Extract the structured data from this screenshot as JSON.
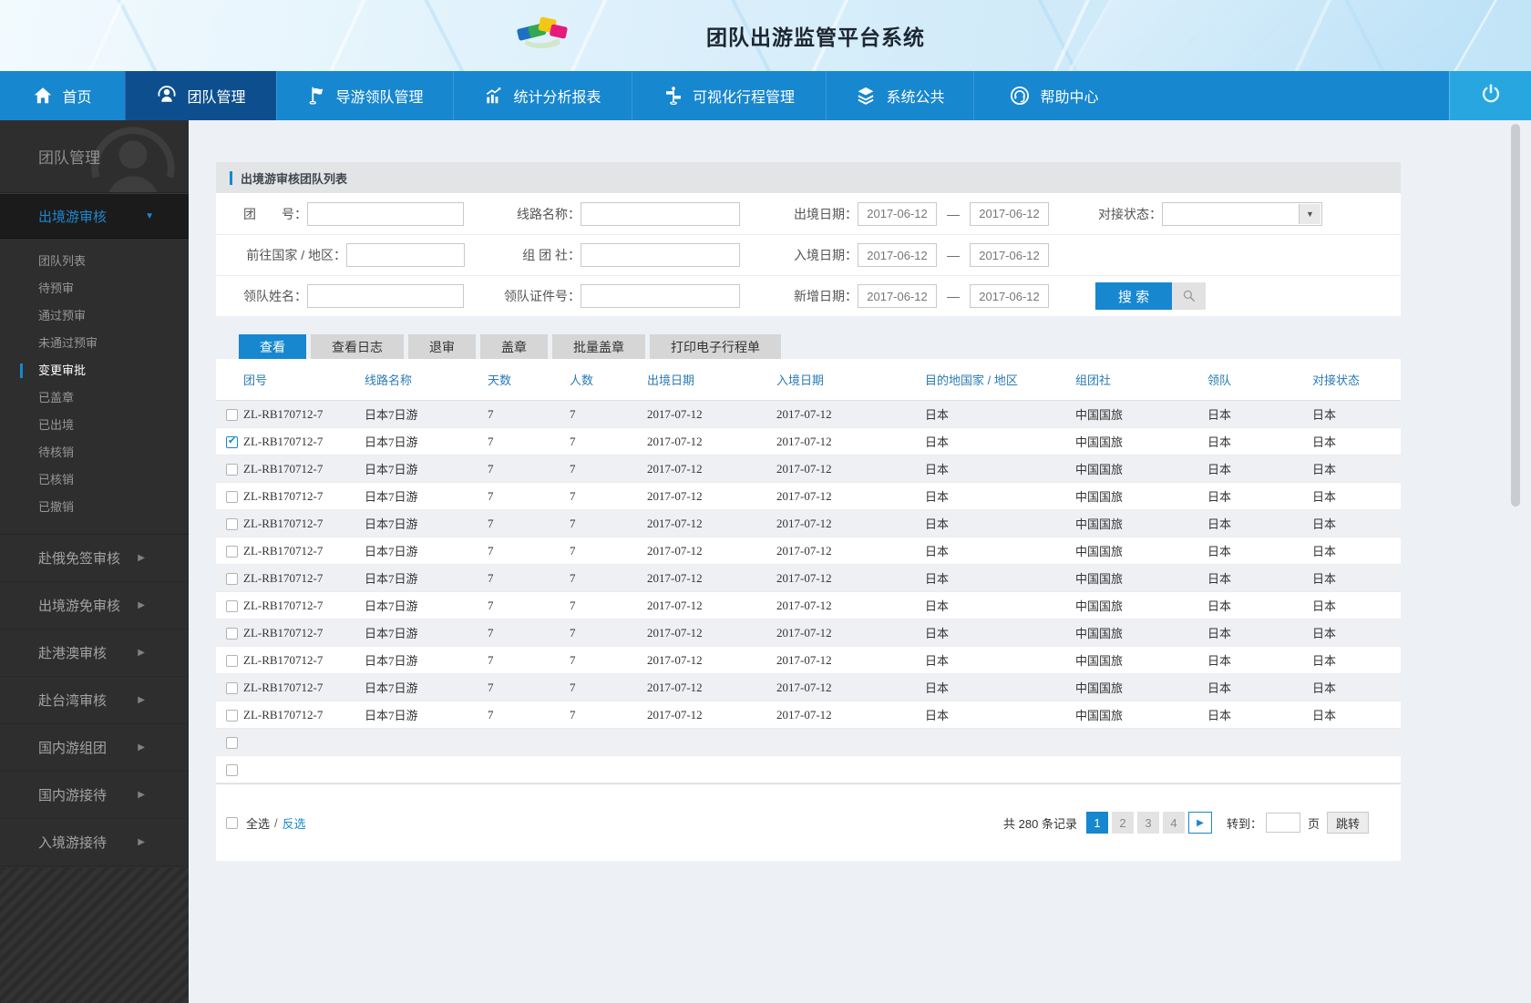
{
  "header": {
    "title": "团队出游监管平台系统"
  },
  "nav": {
    "items": [
      {
        "label": "首页",
        "icon": "home",
        "active": false
      },
      {
        "label": "团队管理",
        "icon": "team",
        "active": true
      },
      {
        "label": "导游领队管理",
        "icon": "flag",
        "active": false
      },
      {
        "label": "统计分析报表",
        "icon": "chart",
        "active": false
      },
      {
        "label": "可视化行程管理",
        "icon": "signpost",
        "active": false
      },
      {
        "label": "系统公共",
        "icon": "layers",
        "active": false
      },
      {
        "label": "帮助中心",
        "icon": "headset",
        "active": false
      }
    ]
  },
  "sidebar": {
    "title": "团队管理",
    "expanded_section": {
      "label": "出境游审核",
      "caret": "▼"
    },
    "sub_items": [
      "团队列表",
      "待预审",
      "通过预审",
      "未通过预审",
      "变更审批",
      "已盖章",
      "已出境",
      "待核销",
      "已核销",
      "已撤销"
    ],
    "active_sub_index": 4,
    "collapsed_sections": [
      "赴俄免签审核",
      "出境游免审核",
      "赴港澳审核",
      "赴台湾审核",
      "国内游组团",
      "国内游接待",
      "入境游接待"
    ],
    "caret_right": "▶"
  },
  "panel": {
    "title": "出境游审核团队列表"
  },
  "search_form": {
    "fields": [
      {
        "label": "团　　号：",
        "value": ""
      },
      {
        "label": "线路名称：",
        "value": ""
      },
      {
        "label": "出境日期：",
        "from": "2017-06-12",
        "to": "2017-06-12"
      },
      {
        "label": "对接状态：",
        "value": ""
      },
      {
        "label": "前往国家 / 地区：",
        "value": ""
      },
      {
        "label": "组 团 社：",
        "value": ""
      },
      {
        "label": "入境日期：",
        "from": "2017-06-12",
        "to": "2017-06-12"
      },
      {
        "label": "领队姓名：",
        "value": ""
      },
      {
        "label": "领队证件号：",
        "value": ""
      },
      {
        "label": "新增日期：",
        "from": "2017-06-12",
        "to": "2017-06-12"
      }
    ],
    "date_separator": "—",
    "search_button": "搜 索",
    "dropdown_caret": "▼"
  },
  "toolbar": {
    "buttons": [
      {
        "label": "查看",
        "active": true
      },
      {
        "label": "查看日志",
        "active": false
      },
      {
        "label": "退审",
        "active": false
      },
      {
        "label": "盖章",
        "active": false
      },
      {
        "label": "批量盖章",
        "active": false
      },
      {
        "label": "打印电子行程单",
        "active": false
      }
    ]
  },
  "table": {
    "columns": [
      "团号",
      "线路名称",
      "天数",
      "人数",
      "出境日期",
      "入境日期",
      "目的地国家 / 地区",
      "组团社",
      "领队",
      "对接状态"
    ],
    "rows": [
      {
        "checked": false,
        "cells": [
          "ZL-RB170712-7",
          "日本7日游",
          "7",
          "7",
          "2017-07-12",
          "2017-07-12",
          "日本",
          "中国国旅",
          "日本",
          "日本"
        ]
      },
      {
        "checked": true,
        "cells": [
          "ZL-RB170712-7",
          "日本7日游",
          "7",
          "7",
          "2017-07-12",
          "2017-07-12",
          "日本",
          "中国国旅",
          "日本",
          "日本"
        ]
      },
      {
        "checked": false,
        "cells": [
          "ZL-RB170712-7",
          "日本7日游",
          "7",
          "7",
          "2017-07-12",
          "2017-07-12",
          "日本",
          "中国国旅",
          "日本",
          "日本"
        ]
      },
      {
        "checked": false,
        "cells": [
          "ZL-RB170712-7",
          "日本7日游",
          "7",
          "7",
          "2017-07-12",
          "2017-07-12",
          "日本",
          "中国国旅",
          "日本",
          "日本"
        ]
      },
      {
        "checked": false,
        "cells": [
          "ZL-RB170712-7",
          "日本7日游",
          "7",
          "7",
          "2017-07-12",
          "2017-07-12",
          "日本",
          "中国国旅",
          "日本",
          "日本"
        ]
      },
      {
        "checked": false,
        "cells": [
          "ZL-RB170712-7",
          "日本7日游",
          "7",
          "7",
          "2017-07-12",
          "2017-07-12",
          "日本",
          "中国国旅",
          "日本",
          "日本"
        ]
      },
      {
        "checked": false,
        "cells": [
          "ZL-RB170712-7",
          "日本7日游",
          "7",
          "7",
          "2017-07-12",
          "2017-07-12",
          "日本",
          "中国国旅",
          "日本",
          "日本"
        ]
      },
      {
        "checked": false,
        "cells": [
          "ZL-RB170712-7",
          "日本7日游",
          "7",
          "7",
          "2017-07-12",
          "2017-07-12",
          "日本",
          "中国国旅",
          "日本",
          "日本"
        ]
      },
      {
        "checked": false,
        "cells": [
          "ZL-RB170712-7",
          "日本7日游",
          "7",
          "7",
          "2017-07-12",
          "2017-07-12",
          "日本",
          "中国国旅",
          "日本",
          "日本"
        ]
      },
      {
        "checked": false,
        "cells": [
          "ZL-RB170712-7",
          "日本7日游",
          "7",
          "7",
          "2017-07-12",
          "2017-07-12",
          "日本",
          "中国国旅",
          "日本",
          "日本"
        ]
      },
      {
        "checked": false,
        "cells": [
          "ZL-RB170712-7",
          "日本7日游",
          "7",
          "7",
          "2017-07-12",
          "2017-07-12",
          "日本",
          "中国国旅",
          "日本",
          "日本"
        ]
      },
      {
        "checked": false,
        "cells": [
          "ZL-RB170712-7",
          "日本7日游",
          "7",
          "7",
          "2017-07-12",
          "2017-07-12",
          "日本",
          "中国国旅",
          "日本",
          "日本"
        ]
      }
    ],
    "empty_row_count": 2
  },
  "footer": {
    "select_all": "全选",
    "separator": "/",
    "invert_select": "反选",
    "total_prefix": "共",
    "total_count": "280",
    "total_suffix": "条记录",
    "pages": [
      "1",
      "2",
      "3",
      "4"
    ],
    "active_page": "1",
    "next_symbol": "▶",
    "goto_label": "转到：",
    "page_suffix": "页",
    "jump_button": "跳转"
  },
  "colors": {
    "nav_blue": "#1787d0",
    "nav_active_blue": "#0d4f8e",
    "power_blue": "#27a6e0",
    "sidebar_dark": "#2e2e2e",
    "row_alt_gray": "#eef0f3",
    "accent_blue": "#1787d0"
  }
}
